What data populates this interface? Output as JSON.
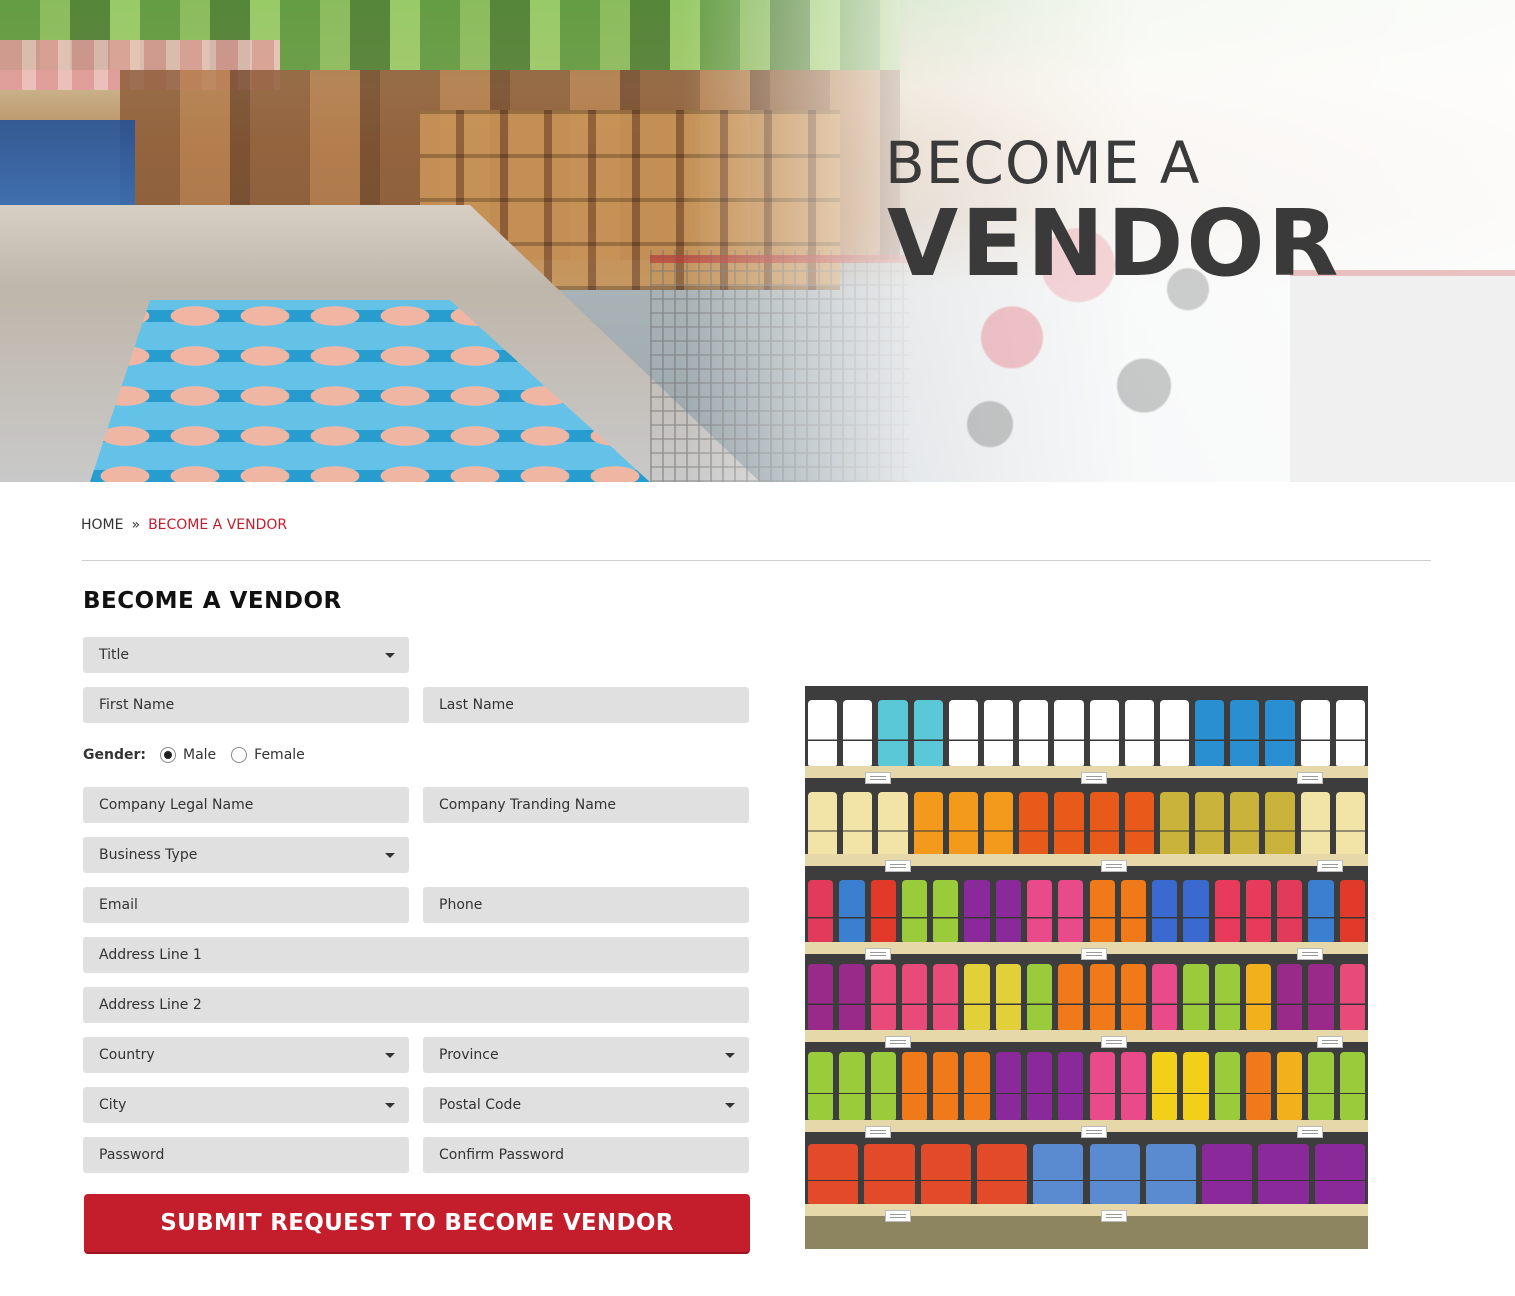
{
  "hero": {
    "title_line1": "BECOME A",
    "title_line2": "VENDOR"
  },
  "breadcrumb": {
    "home": "HOME",
    "separator": "»",
    "current": "BECOME A VENDOR"
  },
  "form": {
    "heading": "BECOME A VENDOR",
    "title_select": "Title",
    "first_name": "First Name",
    "last_name": "Last Name",
    "gender_label": "Gender:",
    "gender_options": [
      "Male",
      "Female"
    ],
    "gender_selected": "Male",
    "company_legal_name": "Company Legal Name",
    "company_trading_name": "Company Tranding Name",
    "business_type": "Business Type",
    "email": "Email",
    "phone": "Phone",
    "address_line_1": "Address Line 1",
    "address_line_2": "Address Line 2",
    "country": "Country",
    "province": "Province",
    "city": "City",
    "postal_code": "Postal Code",
    "password": "Password",
    "confirm_password": "Confirm Password",
    "submit_label": "SUBMIT REQUEST TO BECOME VENDOR"
  },
  "colors": {
    "accent_red": "#c41e2c",
    "field_bg": "#e0e0e0",
    "heading_dark": "#3a3a3a"
  },
  "illustration": {
    "name": "grocery-shelves-illustration"
  }
}
